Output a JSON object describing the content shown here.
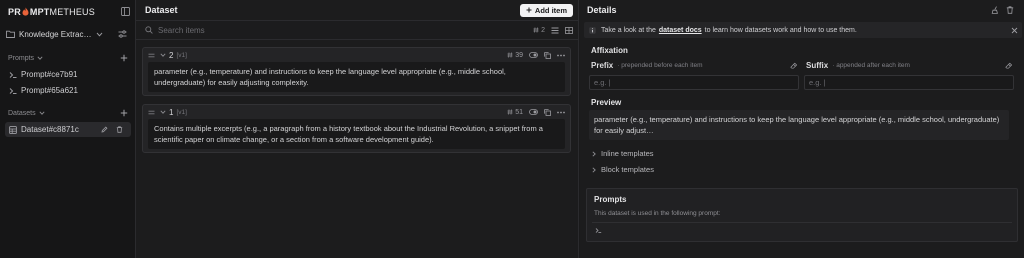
{
  "brand": {
    "logo_pre": "PR",
    "logo_mid": "MPT",
    "logo_post": "METHEUS"
  },
  "project": {
    "name": "Knowledge Extrac…"
  },
  "sidebar": {
    "prompts_label": "Prompts",
    "prompts": [
      {
        "label": "Prompt#ce7b91"
      },
      {
        "label": "Prompt#65a621"
      }
    ],
    "datasets_label": "Datasets",
    "datasets": [
      {
        "label": "Dataset#c8871c"
      }
    ]
  },
  "dataset": {
    "title": "Dataset",
    "add_item_label": "Add item",
    "search_placeholder": "Search items",
    "item_count": "2",
    "items": [
      {
        "num": "2",
        "version": "[v1]",
        "tokens": "39",
        "text": "parameter (e.g., temperature) and instructions to keep the language level appropriate (e.g., middle school, undergraduate) for easily adjusting complexity."
      },
      {
        "num": "1",
        "version": "[v1]",
        "tokens": "51",
        "text": "Contains multiple excerpts (e.g., a paragraph from a history textbook about the Industrial Revolution, a snippet from a scientific paper on climate change, or a section from a software development guide)."
      }
    ]
  },
  "details": {
    "title": "Details",
    "info_pre": "Take a look at the",
    "info_link": "dataset docs",
    "info_post": "to learn how datasets work and how to use them.",
    "affixation_title": "Affixation",
    "prefix_label": "Prefix",
    "prefix_sub": "· prepended before each item",
    "prefix_placeholder": "e.g. |",
    "suffix_label": "Suffix",
    "suffix_sub": "· appended after each item",
    "suffix_placeholder": "e.g. |",
    "preview_title": "Preview",
    "preview_text": "parameter (e.g., temperature) and instructions to keep the language level appropriate (e.g., middle school, undergraduate) for easily adjust…",
    "inline_templates_label": "Inline templates",
    "block_templates_label": "Block templates",
    "prompts_title": "Prompts",
    "prompts_desc": "This dataset is used in the following prompt:"
  },
  "colors": {
    "accent": "#f2f2f3",
    "flame": "#e8633a",
    "background": "#1c1c1d"
  }
}
